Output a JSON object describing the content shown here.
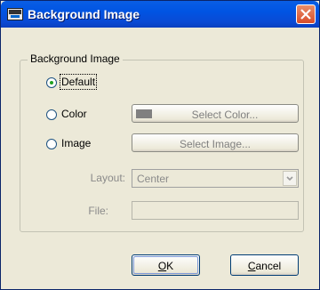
{
  "window": {
    "title": "Background Image",
    "close_label": "Close"
  },
  "group": {
    "legend": "Background Image"
  },
  "options": {
    "default_label": "Default",
    "color_label": "Color",
    "image_label": "Image",
    "selected": "Default"
  },
  "buttons": {
    "select_color": "Select Color...",
    "select_image": "Select Image...",
    "ok_mnemonic": "O",
    "ok_rest": "K",
    "cancel_mnemonic": "C",
    "cancel_rest": "ancel"
  },
  "layout_field": {
    "label": "Layout:",
    "value": "Center"
  },
  "file_field": {
    "label": "File:",
    "value": ""
  },
  "colors": {
    "title_bar": "#0054e3",
    "dialog_bg": "#ece9d8",
    "swatch": "#808080",
    "radio_dot": "#21a121",
    "close_button": "#d94d2a"
  },
  "icons": {
    "app_icon": "dme-app-icon",
    "close": "close-icon",
    "dropdown": "chevron-down-icon"
  }
}
